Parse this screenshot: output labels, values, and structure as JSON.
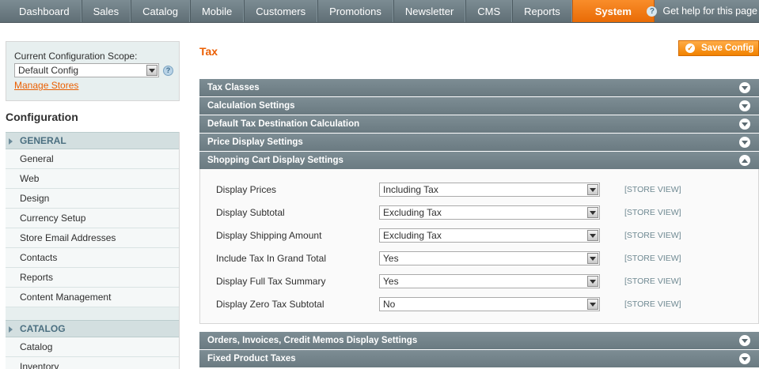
{
  "nav": {
    "items": [
      "Dashboard",
      "Sales",
      "Catalog",
      "Mobile",
      "Customers",
      "Promotions",
      "Newsletter",
      "CMS",
      "Reports",
      "System"
    ],
    "active": "System",
    "help_label": "Get help for this page"
  },
  "scope": {
    "label": "Current Configuration Scope:",
    "selected": "Default Config",
    "manage_link": "Manage Stores"
  },
  "sidebar": {
    "title": "Configuration",
    "groups": [
      {
        "label": "GENERAL",
        "items": [
          "General",
          "Web",
          "Design",
          "Currency Setup",
          "Store Email Addresses",
          "Contacts",
          "Reports",
          "Content Management"
        ]
      },
      {
        "label": "CATALOG",
        "items": [
          "Catalog",
          "Inventory"
        ]
      }
    ]
  },
  "main": {
    "title": "Tax",
    "save_label": "Save Config",
    "sections": [
      {
        "label": "Tax Classes",
        "expanded": false
      },
      {
        "label": "Calculation Settings",
        "expanded": false
      },
      {
        "label": "Default Tax Destination Calculation",
        "expanded": false
      },
      {
        "label": "Price Display Settings",
        "expanded": false
      },
      {
        "label": "Shopping Cart Display Settings",
        "expanded": true
      },
      {
        "label": "Orders, Invoices, Credit Memos Display Settings",
        "expanded": false
      },
      {
        "label": "Fixed Product Taxes",
        "expanded": false
      }
    ],
    "cart_fields": [
      {
        "label": "Display Prices",
        "value": "Including Tax",
        "scope": "[STORE VIEW]"
      },
      {
        "label": "Display Subtotal",
        "value": "Excluding Tax",
        "scope": "[STORE VIEW]"
      },
      {
        "label": "Display Shipping Amount",
        "value": "Excluding Tax",
        "scope": "[STORE VIEW]"
      },
      {
        "label": "Include Tax In Grand Total",
        "value": "Yes",
        "scope": "[STORE VIEW]"
      },
      {
        "label": "Display Full Tax Summary",
        "value": "Yes",
        "scope": "[STORE VIEW]"
      },
      {
        "label": "Display Zero Tax Subtotal",
        "value": "No",
        "scope": "[STORE VIEW]"
      }
    ]
  },
  "colors": {
    "accent": "#eb5e00",
    "nav_bg": "#6f7f86",
    "section_bg": "#748489"
  }
}
